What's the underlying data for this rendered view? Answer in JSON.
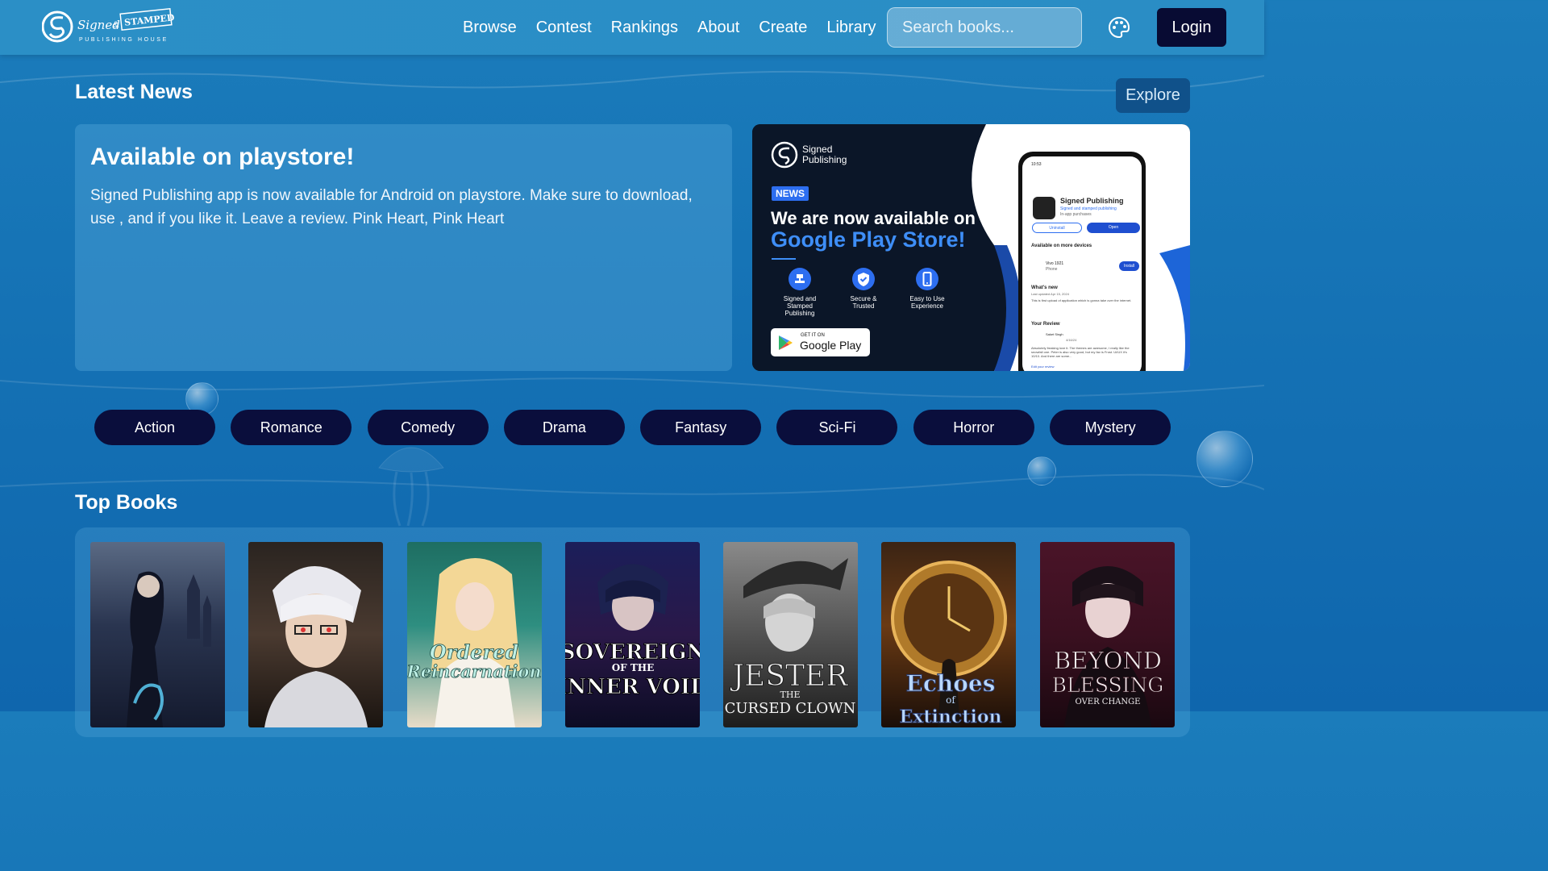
{
  "brand": {
    "logo_script": "Signed",
    "logo_amp": "&",
    "logo_stamp": "STAMPED",
    "logo_sub": "PUBLISHING HOUSE"
  },
  "nav": {
    "links": [
      "Browse",
      "Contest",
      "Rankings",
      "About",
      "Create",
      "Library"
    ],
    "search_placeholder": "Search books...",
    "login_label": "Login"
  },
  "latest_news": {
    "title": "Latest News",
    "explore_label": "Explore",
    "headline": "Available on playstore!",
    "body": "Signed Publishing app is now available for Android on playstore. Make sure to download, use , and if you like it. Leave a review. Pink Heart, Pink Heart"
  },
  "banner": {
    "brand_line1": "Signed",
    "brand_line2": "Publishing",
    "badge": "NEWS",
    "line1": "We are now available on",
    "line2": "Google Play Store!",
    "features": [
      {
        "label1": "Signed and",
        "label2": "Stamped",
        "label3": "Publishing",
        "icon": "stamp-icon"
      },
      {
        "label1": "Secure &",
        "label2": "Trusted",
        "label3": "",
        "icon": "shield-check-icon"
      },
      {
        "label1": "Easy to Use",
        "label2": "Experience",
        "label3": "",
        "icon": "phone-icon"
      }
    ],
    "play_small": "GET IT ON",
    "play_big": "Google Play",
    "phone": {
      "time": "10:53",
      "app_name": "Signed Publishing",
      "app_sub": "Signed and stamped publishing",
      "app_sub2": "In-app purchases",
      "uninstall": "Uninstall",
      "open": "Open",
      "devices_title": "Available on more devices",
      "device_name": "Vivo 1921",
      "device_type": "Phone",
      "install": "Install",
      "whats_new": "What's new",
      "updated": "Last updated Apr 15, 2024",
      "whats_new_text": "This is first upload of application which is gonna take over the internet.",
      "review_title": "Your Review",
      "reviewer": "Saket Singh",
      "review_date": "4/16/24",
      "review_text": "Absolutely freaking love it. The themes are awesome, I really like the snowfall one. Peter is also very good, but my fav is Frost. UI/UX it's 10/10. And there are some...",
      "edit_review": "Edit your review"
    }
  },
  "genres": [
    "Action",
    "Romance",
    "Comedy",
    "Drama",
    "Fantasy",
    "Sci-Fi",
    "Horror",
    "Mystery"
  ],
  "top_books": {
    "title": "Top Books",
    "books": [
      {
        "title_lines": [],
        "theme": "dark-castle"
      },
      {
        "title_lines": [],
        "theme": "white-hair"
      },
      {
        "title_lines": [
          "Ordered",
          "Reincarnation"
        ],
        "theme": "elf-teal"
      },
      {
        "title_lines": [
          "SOVEREIGN",
          "OF THE",
          "INNER VOID"
        ],
        "theme": "void-purple"
      },
      {
        "title_lines": [
          "JESTER",
          "THE",
          "CURSED CLOWN"
        ],
        "theme": "grey-jester"
      },
      {
        "title_lines": [
          "Echoes",
          "of",
          "Extinction"
        ],
        "theme": "clock-gold"
      },
      {
        "title_lines": [
          "BEYOND",
          "BLESSING",
          "OVER CHANGE"
        ],
        "theme": "crimson"
      }
    ]
  },
  "colors": {
    "nav_bg": "#2a8dc5",
    "page_bg": "#1674b6",
    "dark_button": "#080b33",
    "explore_bg": "#10518a",
    "banner_accent": "#3e8ef7"
  }
}
